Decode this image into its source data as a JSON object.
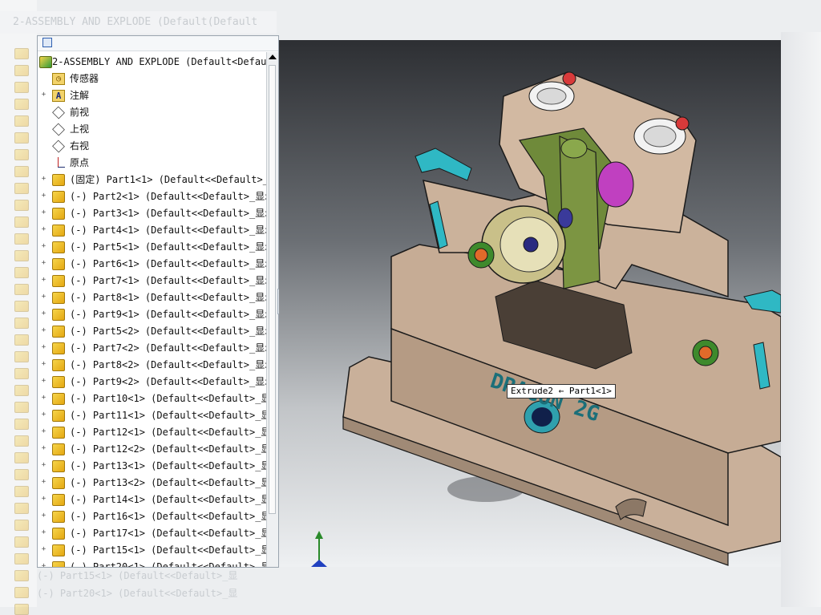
{
  "window": {
    "ghost_title": "2-ASSEMBLY AND EXPLODE  (Default(Default"
  },
  "tree": {
    "root_label": "2-ASSEMBLY AND EXPLODE  (Default<Defau",
    "items": [
      {
        "label": "传感器",
        "icon": "sensor-icon",
        "kind": "sensor"
      },
      {
        "label": "注解",
        "icon": "annotation-icon",
        "kind": "anno"
      },
      {
        "label": "前视",
        "icon": "plane-icon",
        "kind": "plane"
      },
      {
        "label": "上视",
        "icon": "plane-icon",
        "kind": "plane"
      },
      {
        "label": "右视",
        "icon": "plane-icon",
        "kind": "plane"
      },
      {
        "label": "原点",
        "icon": "origin-icon",
        "kind": "origin"
      }
    ],
    "parts": [
      "(固定) Part1<1> (Default<<Default>_",
      "(-) Part2<1> (Default<<Default>_显示",
      "(-) Part3<1> (Default<<Default>_显示",
      "(-) Part4<1> (Default<<Default>_显示",
      "(-) Part5<1> (Default<<Default>_显示",
      "(-) Part6<1> (Default<<Default>_显示",
      "(-) Part7<1> (Default<<Default>_显示",
      "(-) Part8<1> (Default<<Default>_显示",
      "(-) Part9<1> (Default<<Default>_显示",
      "(-) Part5<2> (Default<<Default>_显示",
      "(-) Part7<2> (Default<<Default>_显示",
      "(-) Part8<2> (Default<<Default>_显示",
      "(-) Part9<2> (Default<<Default>_显示",
      "(-) Part10<1> (Default<<Default>_显",
      "(-) Part11<1> (Default<<Default>_显",
      "(-) Part12<1> (Default<<Default>_显",
      "(-) Part12<2> (Default<<Default>_显",
      "(-) Part13<1> (Default<<Default>_显",
      "(-) Part13<2> (Default<<Default>_显",
      "(-) Part14<1> (Default<<Default>_显",
      "(-) Part16<1> (Default<<Default>_显",
      "(-) Part17<1> (Default<<Default>_显",
      "(-) Part15<1> (Default<<Default>_显",
      "(-) Part20<1> (Default<<Default>_显"
    ],
    "ghost_rows": [
      "(-) Part15<1> (Default<<Default>_显",
      "(-) Part20<1> (Default<<Default>_显"
    ]
  },
  "viewport": {
    "tooltip": "Extrude2 ← Part1<1>",
    "embossed_text": "DRAGON 2G",
    "colors": {
      "body": "#c9b09a",
      "edge": "#1a1a1a",
      "cyan": "#2fb8c4",
      "green": "#6f8a3a",
      "magenta": "#c040c0",
      "text": "#1b6f79"
    }
  },
  "splitter": {
    "glyph": "◂◂"
  }
}
